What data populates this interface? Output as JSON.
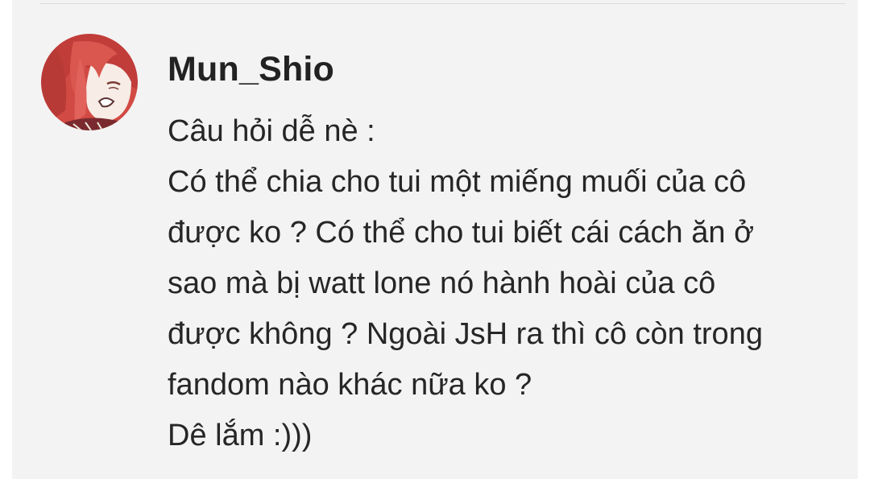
{
  "comment": {
    "username": "Mun_Shio",
    "lines": [
      "Câu hỏi dễ nè :",
      "Có thể chia cho tui một miếng muối của cô",
      "được ko ? Có thể cho tui biết cái cách ăn ở",
      "sao mà bị watt lone nó hành hoài của cô",
      "được không ? Ngoài JsH ra thì cô còn trong",
      "fandom nào khác nữa ko ?",
      "Dê lắm :)))"
    ],
    "avatar_icon": "anime-character-avatar"
  },
  "colors": {
    "background": "#f3f3f3",
    "text": "#262626",
    "username": "#222222",
    "avatar_hair": "#c8473f"
  }
}
